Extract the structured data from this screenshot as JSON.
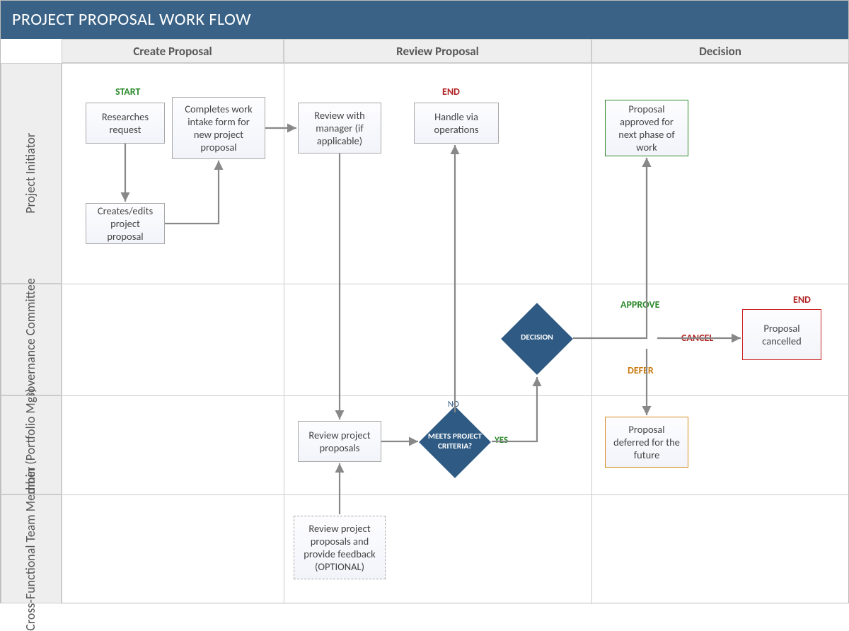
{
  "title": "PROJECT PROPOSAL WORK FLOW",
  "columns": [
    "Create Proposal",
    "Review Proposal",
    "Decision"
  ],
  "rows": [
    "Project Initiator",
    "Governance Committee",
    "Admin (Portfolio Mgr)",
    "Cross-Functional Team Member"
  ],
  "boxes": {
    "researches": "Researches request",
    "creates_edits": "Creates/edits project proposal",
    "completes_intake": "Completes work intake form for new project proposal",
    "review_manager": "Review with manager (if applicable)",
    "handle_ops": "Handle via operations",
    "review_proposals": "Review project proposals",
    "review_feedback": "Review project proposals and provide feedback (OPTIONAL)",
    "approved": "Proposal approved for next phase of work",
    "cancelled": "Proposal cancelled",
    "deferred": "Proposal deferred for the future"
  },
  "diamonds": {
    "meets_criteria": "MEETS PROJECT CRITERIA?",
    "decision": "DECISION"
  },
  "labels": {
    "start": "START",
    "end_top": "END",
    "end_right": "END",
    "approve": "APPROVE",
    "cancel": "CANCEL",
    "defer": "DEFER",
    "yes": "YES",
    "no": "NO"
  }
}
